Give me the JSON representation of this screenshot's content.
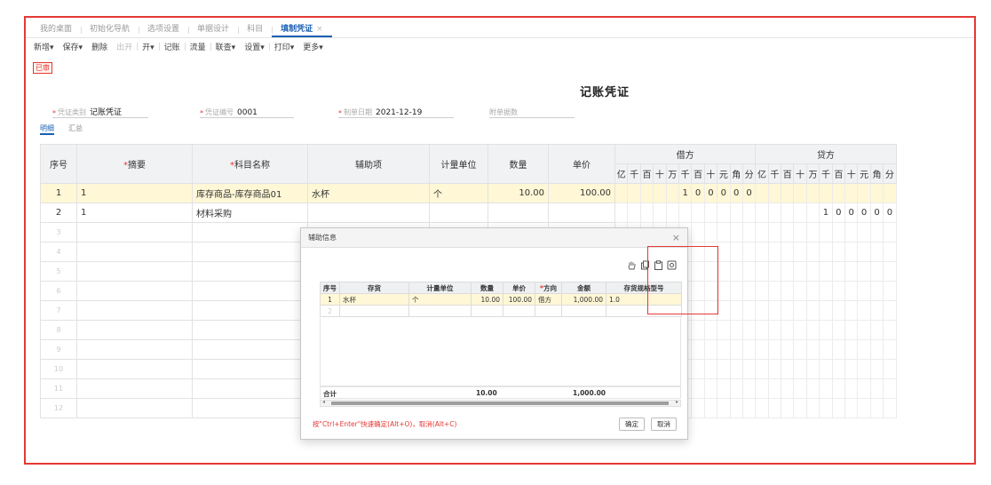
{
  "tabs": [
    {
      "label": "我的桌面",
      "active": false
    },
    {
      "label": "初始化导航",
      "active": false
    },
    {
      "label": "选项设置",
      "active": false
    },
    {
      "label": "单据设计",
      "active": false
    },
    {
      "label": "科目",
      "active": false
    },
    {
      "label": "填制凭证",
      "active": true
    }
  ],
  "tab_close": "×",
  "toolbar": [
    "新增▾",
    "保存▾",
    "删除",
    "出开",
    "开▾",
    "记账",
    "流量",
    "联查▾",
    "设置▾",
    "打印▾",
    "更多▾"
  ],
  "status_tag": "已审",
  "title": "记账凭证",
  "header": {
    "voucher_type_label": "凭证类别",
    "voucher_type_value": "记账凭证",
    "voucher_no_label": "凭证编号",
    "voucher_no_value": "0001",
    "date_label": "制单日期",
    "date_value": "2021-12-19",
    "attachments_label": "附单据数",
    "attachments_value": ""
  },
  "subtabs": [
    "明细",
    "汇总"
  ],
  "columns": {
    "seq": "序号",
    "summary": "摘要",
    "account": "科目名称",
    "aux": "辅助项",
    "unit": "计量单位",
    "qty": "数量",
    "price": "单价",
    "debit": "借方",
    "credit": "贷方"
  },
  "digit_headers": [
    "亿",
    "千",
    "百",
    "十",
    "万",
    "千",
    "百",
    "十",
    "元",
    "角",
    "分"
  ],
  "rows": [
    {
      "seq": "1",
      "summary": "1",
      "account": "库存商品-库存商品01",
      "aux": "水杯",
      "unit": "个",
      "qty": "10.00",
      "price": "100.00",
      "debit_digits": [
        "",
        "",
        "",
        "",
        "",
        "1",
        "0",
        "0",
        "0",
        "0",
        "0"
      ],
      "credit_digits": [
        "",
        "",
        "",
        "",
        "",
        "",
        "",
        "",
        "",
        "",
        ""
      ]
    },
    {
      "seq": "2",
      "summary": "1",
      "account": "材料采购",
      "aux": "",
      "unit": "",
      "qty": "",
      "price": "",
      "debit_digits": [
        "",
        "",
        "",
        "",
        "",
        "",
        "",
        "",
        "",
        "",
        ""
      ],
      "credit_digits": [
        "",
        "",
        "",
        "",
        "",
        "1",
        "0",
        "0",
        "0",
        "0",
        "0"
      ]
    },
    {
      "seq": "3"
    },
    {
      "seq": "4"
    },
    {
      "seq": "5"
    },
    {
      "seq": "6"
    },
    {
      "seq": "7"
    },
    {
      "seq": "8"
    },
    {
      "seq": "9"
    },
    {
      "seq": "10"
    },
    {
      "seq": "11"
    },
    {
      "seq": "12"
    }
  ],
  "dialog": {
    "title": "辅助信息",
    "close": "×",
    "columns": {
      "seq": "序号",
      "item": "存货",
      "unit": "计量单位",
      "qty": "数量",
      "price": "单价",
      "direction": "方向",
      "amount": "金额",
      "spec": "存货规格型号"
    },
    "rows": [
      {
        "seq": "1",
        "item": "水杯",
        "unit": "个",
        "qty": "10.00",
        "price": "100.00",
        "direction": "借方",
        "amount": "1,000.00",
        "spec": "1.0"
      },
      {
        "seq": "2",
        "item": "",
        "unit": "",
        "qty": "",
        "price": "",
        "direction": "",
        "amount": "",
        "spec": ""
      }
    ],
    "total_label": "合计",
    "total_qty": "10.00",
    "total_amount": "1,000.00",
    "hint": "按\"Ctrl+Enter\"快速确定(Alt+O)，取消(Alt+C)",
    "confirm": "确定",
    "cancel": "取消"
  }
}
